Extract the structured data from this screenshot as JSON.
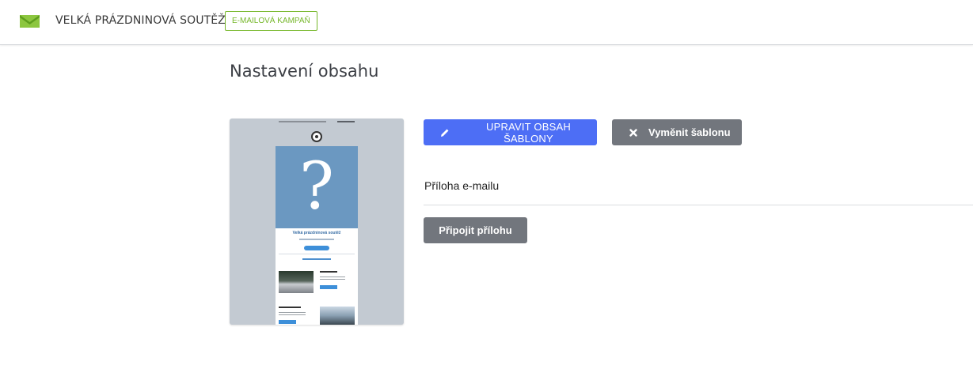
{
  "header": {
    "logo_icon": "green-envelope-icon",
    "campaign_title": "VELKÁ PRÁZDNINOVÁ SOUTĚŽ",
    "campaign_type_badge": "E-MAILOVÁ KAMPAŇ"
  },
  "main": {
    "page_title": "Nastavení obsahu",
    "template_preview": {
      "hero_symbol": "?",
      "heading": "Velká prázdninová soutěž"
    },
    "actions": {
      "edit_template_label": "UPRAVIT OBSAH ŠABLONY",
      "edit_template_icon": "pencil-icon",
      "swap_template_label": "Vyměnit šablonu",
      "swap_template_icon": "close-icon"
    },
    "attachment": {
      "section_label": "Příloha e-mailu",
      "attach_button_label": "Připojit přílohu"
    }
  },
  "colors": {
    "accent_green": "#76b72a",
    "primary_blue": "#4d6ef5",
    "secondary_gray": "#72767d",
    "preview_background": "#c3cad2",
    "preview_hero": "#6b98c1"
  }
}
